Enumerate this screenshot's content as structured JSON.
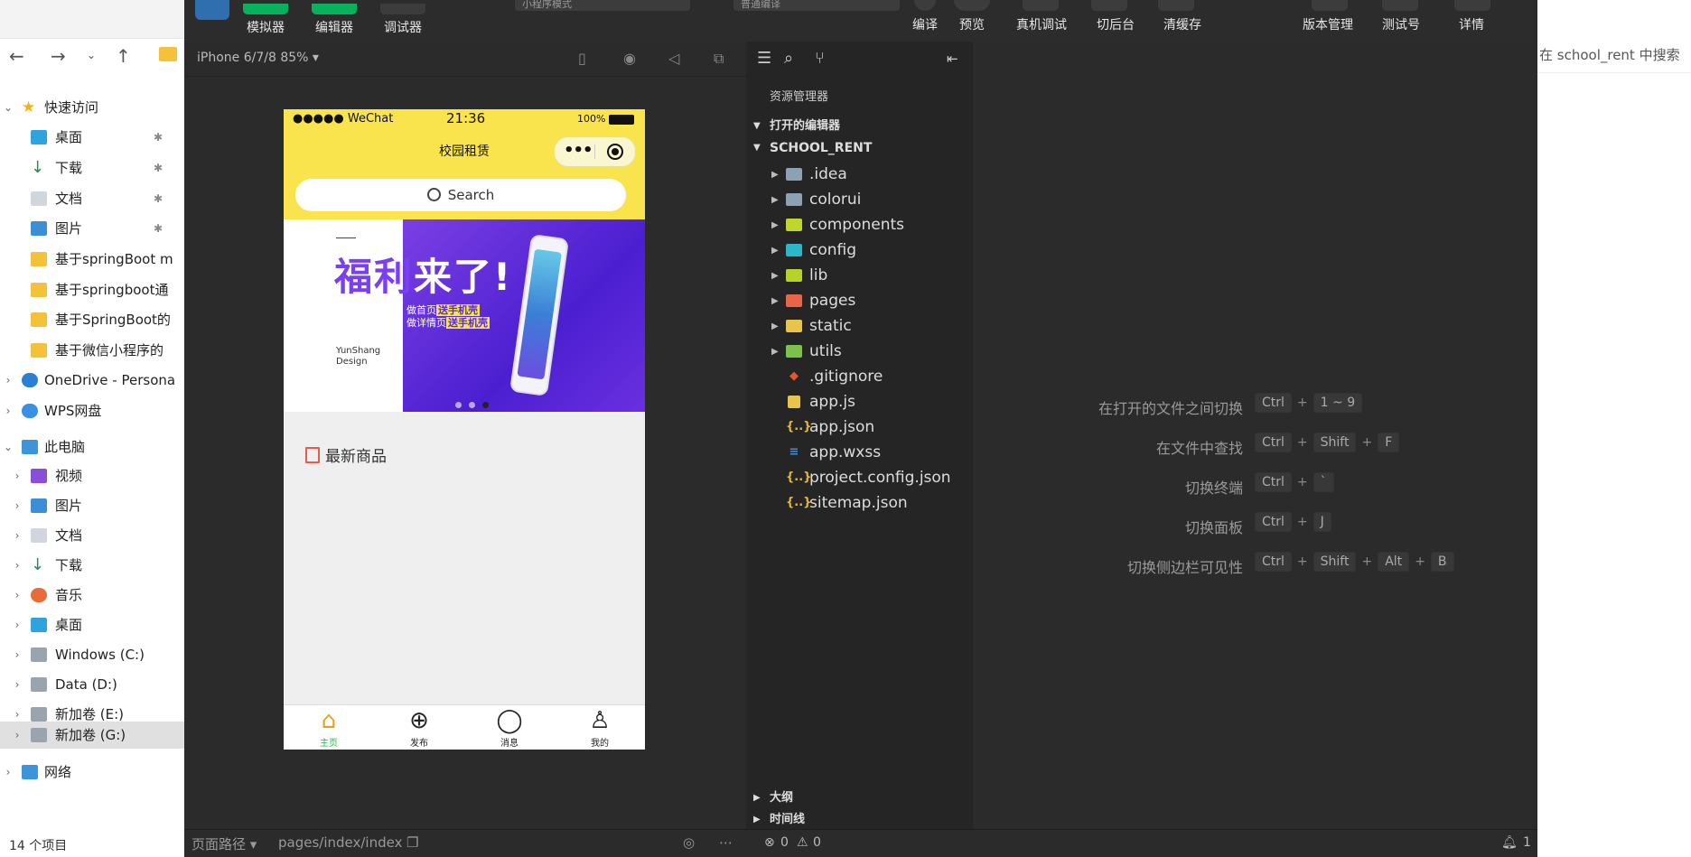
{
  "explorer": {
    "quick_access": "快速访问",
    "items": [
      {
        "label": "桌面",
        "pinned": true
      },
      {
        "label": "下载",
        "pinned": true
      },
      {
        "label": "文档",
        "pinned": true
      },
      {
        "label": "图片",
        "pinned": true
      },
      {
        "label": "基于springBoot m"
      },
      {
        "label": "基于springboot通"
      },
      {
        "label": "基于SpringBoot的"
      },
      {
        "label": "基于微信小程序的"
      }
    ],
    "onedrive": "OneDrive - Persona",
    "wps": "WPS网盘",
    "this_pc": "此电脑",
    "pc_items": [
      "视频",
      "图片",
      "文档",
      "下载",
      "音乐",
      "桌面",
      "Windows (C:)",
      "Data (D:)",
      "新加卷 (E:)",
      "新加卷 (G:)"
    ],
    "network": "网络",
    "status": "14 个项目"
  },
  "toolbar": {
    "simulator": "模拟器",
    "editor": "编辑器",
    "debugger": "调试器",
    "mode": "小程序模式",
    "compile_mode": "普通编译",
    "compile": "编译",
    "preview": "预览",
    "real_debug": "真机调试",
    "background": "切后台",
    "clear_cache": "清缓存",
    "version": "版本管理",
    "test_id": "测试号",
    "details": "详情"
  },
  "simulator": {
    "device": "iPhone 6/7/8 85% ▾",
    "status_carrier": "●●●●● WeChat",
    "status_time": "21:36",
    "status_battery": "100%",
    "nav_title": "校园租赁",
    "search_placeholder": "Search",
    "banner_title_a": "福利",
    "banner_title_b": "来了!",
    "banner_line1a": "做首页",
    "banner_line1b": "送手机壳",
    "banner_line2a": "做详情页",
    "banner_line2b": "送手机壳",
    "banner_brand": "YunShang",
    "banner_brand2": "Design",
    "section_title": "最新商品",
    "tabs": [
      "主页",
      "发布",
      "消息",
      "我的"
    ],
    "footer_path_label": "页面路径 ▾",
    "footer_path": "pages/index/index"
  },
  "filepanel": {
    "title": "资源管理器",
    "open_editors": "打开的编辑器",
    "project": "SCHOOL_RENT",
    "folders": [
      ".idea",
      "colorui",
      "components",
      "config",
      "lib",
      "pages",
      "static",
      "utils"
    ],
    "files": [
      ".gitignore",
      "app.js",
      "app.json",
      "app.wxss",
      "project.config.json",
      "sitemap.json"
    ],
    "outline": "大纲",
    "timeline": "时间线"
  },
  "shortcuts": [
    {
      "label": "在打开的文件之间切换",
      "keys": [
        "Ctrl",
        "1 ~ 9"
      ]
    },
    {
      "label": "在文件中查找",
      "keys": [
        "Ctrl",
        "Shift",
        "F"
      ]
    },
    {
      "label": "切换终端",
      "keys": [
        "Ctrl",
        "`"
      ]
    },
    {
      "label": "切换面板",
      "keys": [
        "Ctrl",
        "J"
      ]
    },
    {
      "label": "切换侧边栏可见性",
      "keys": [
        "Ctrl",
        "Shift",
        "Alt",
        "B"
      ]
    }
  ],
  "statusbar": {
    "errors": "0",
    "warnings": "0",
    "notifications": "1"
  },
  "right_window": {
    "search": "在 school_rent 中搜索"
  }
}
